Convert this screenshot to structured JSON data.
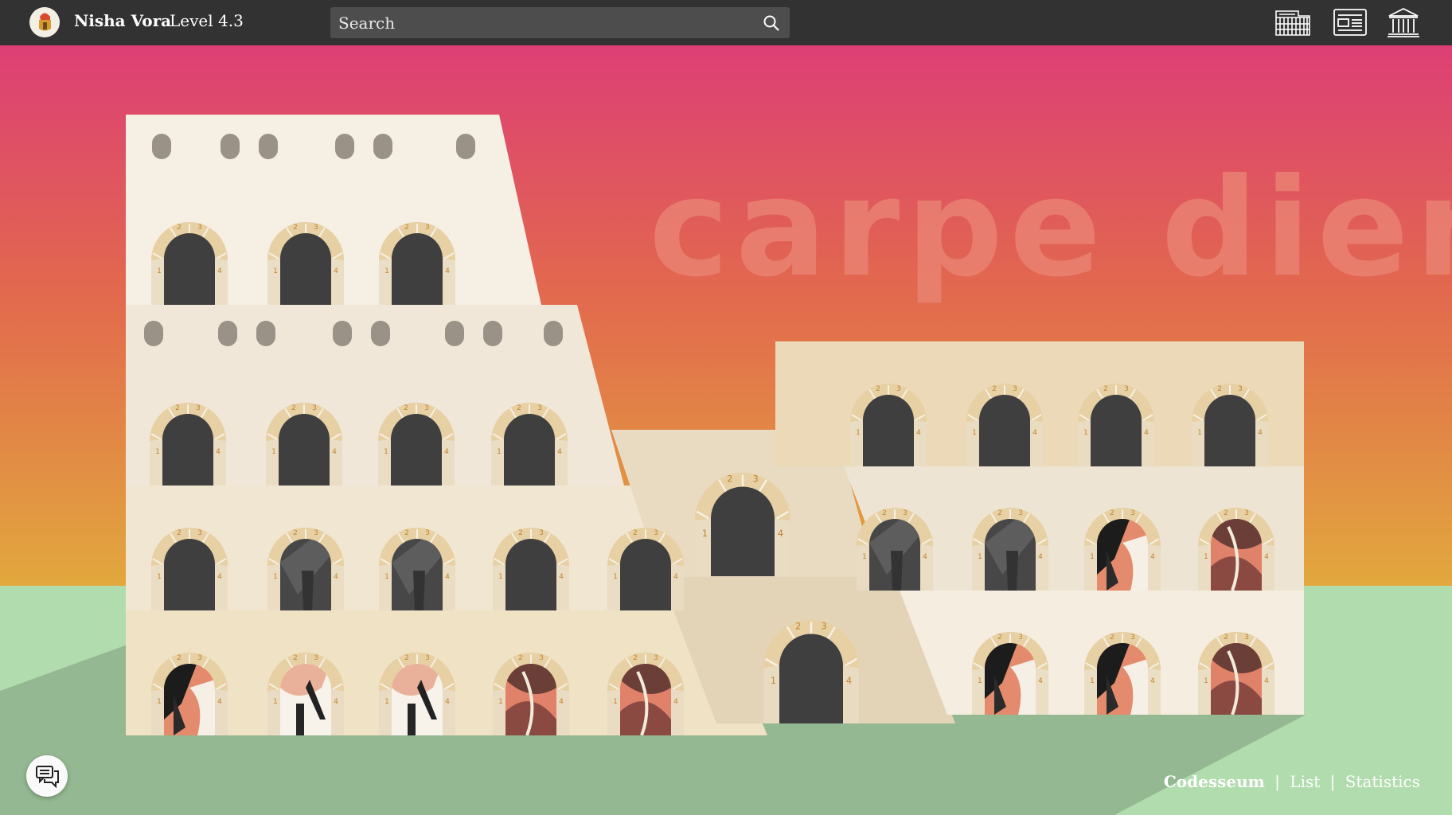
{
  "header": {
    "user_name": "Nisha Vora",
    "level": "Level 4.3",
    "search_placeholder": "Search",
    "nav_icons": [
      "colosseum-icon",
      "newspaper-icon",
      "museum-icon"
    ]
  },
  "scene": {
    "motto": "carpe diem",
    "sky_colors": [
      "#dd4272",
      "#e16a4c",
      "#e39a3e",
      "#e2a83d"
    ],
    "ground_colors": [
      "#b2ddaf",
      "#94b891"
    ],
    "arch_numbers": [
      "1",
      "2",
      "3",
      "4"
    ]
  },
  "footer": {
    "links": [
      "Codesseum",
      "List",
      "Statistics"
    ],
    "separator": "|"
  },
  "icons": {
    "chat": "chat-icon",
    "avatar": "gladiator-helmet-icon"
  }
}
